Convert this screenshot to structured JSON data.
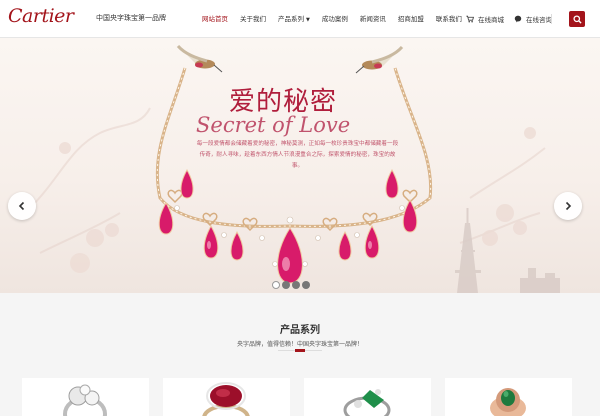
{
  "header": {
    "logo": "Cartier",
    "slogan": "中国央字珠宝第一品牌",
    "nav": [
      {
        "label": "网站首页",
        "active": true,
        "dropdown": false
      },
      {
        "label": "关于我们",
        "active": false,
        "dropdown": false
      },
      {
        "label": "产品系列",
        "active": false,
        "dropdown": true
      },
      {
        "label": "成功案例",
        "active": false,
        "dropdown": false
      },
      {
        "label": "新闻资讯",
        "active": false,
        "dropdown": false
      },
      {
        "label": "招商加盟",
        "active": false,
        "dropdown": false
      },
      {
        "label": "联系我们",
        "active": false,
        "dropdown": false
      }
    ],
    "shop_label": "在线商城",
    "consult_label": "在线咨询",
    "accent_color": "#a3141b"
  },
  "banner": {
    "title": "爱的秘密",
    "subtitle": "Secret of Love",
    "text": "每一段爱情都会储藏着爱的秘密，神秘莫测，正如每一枚珍贵珠宝中都储藏着一段传奇，耐人寻味，趁着东西方情人节浪漫重合之际，探索爱情的秘密，珠宝的故事。",
    "slide_count": 4,
    "active_slide": 1
  },
  "products": {
    "title": "产品系列",
    "subtitle": "央字品牌，值得信赖！中国央字珠宝第一品牌！",
    "cards": [
      "diamond-ring",
      "ruby-ring",
      "emerald-ring",
      "green-gem-ring"
    ]
  }
}
